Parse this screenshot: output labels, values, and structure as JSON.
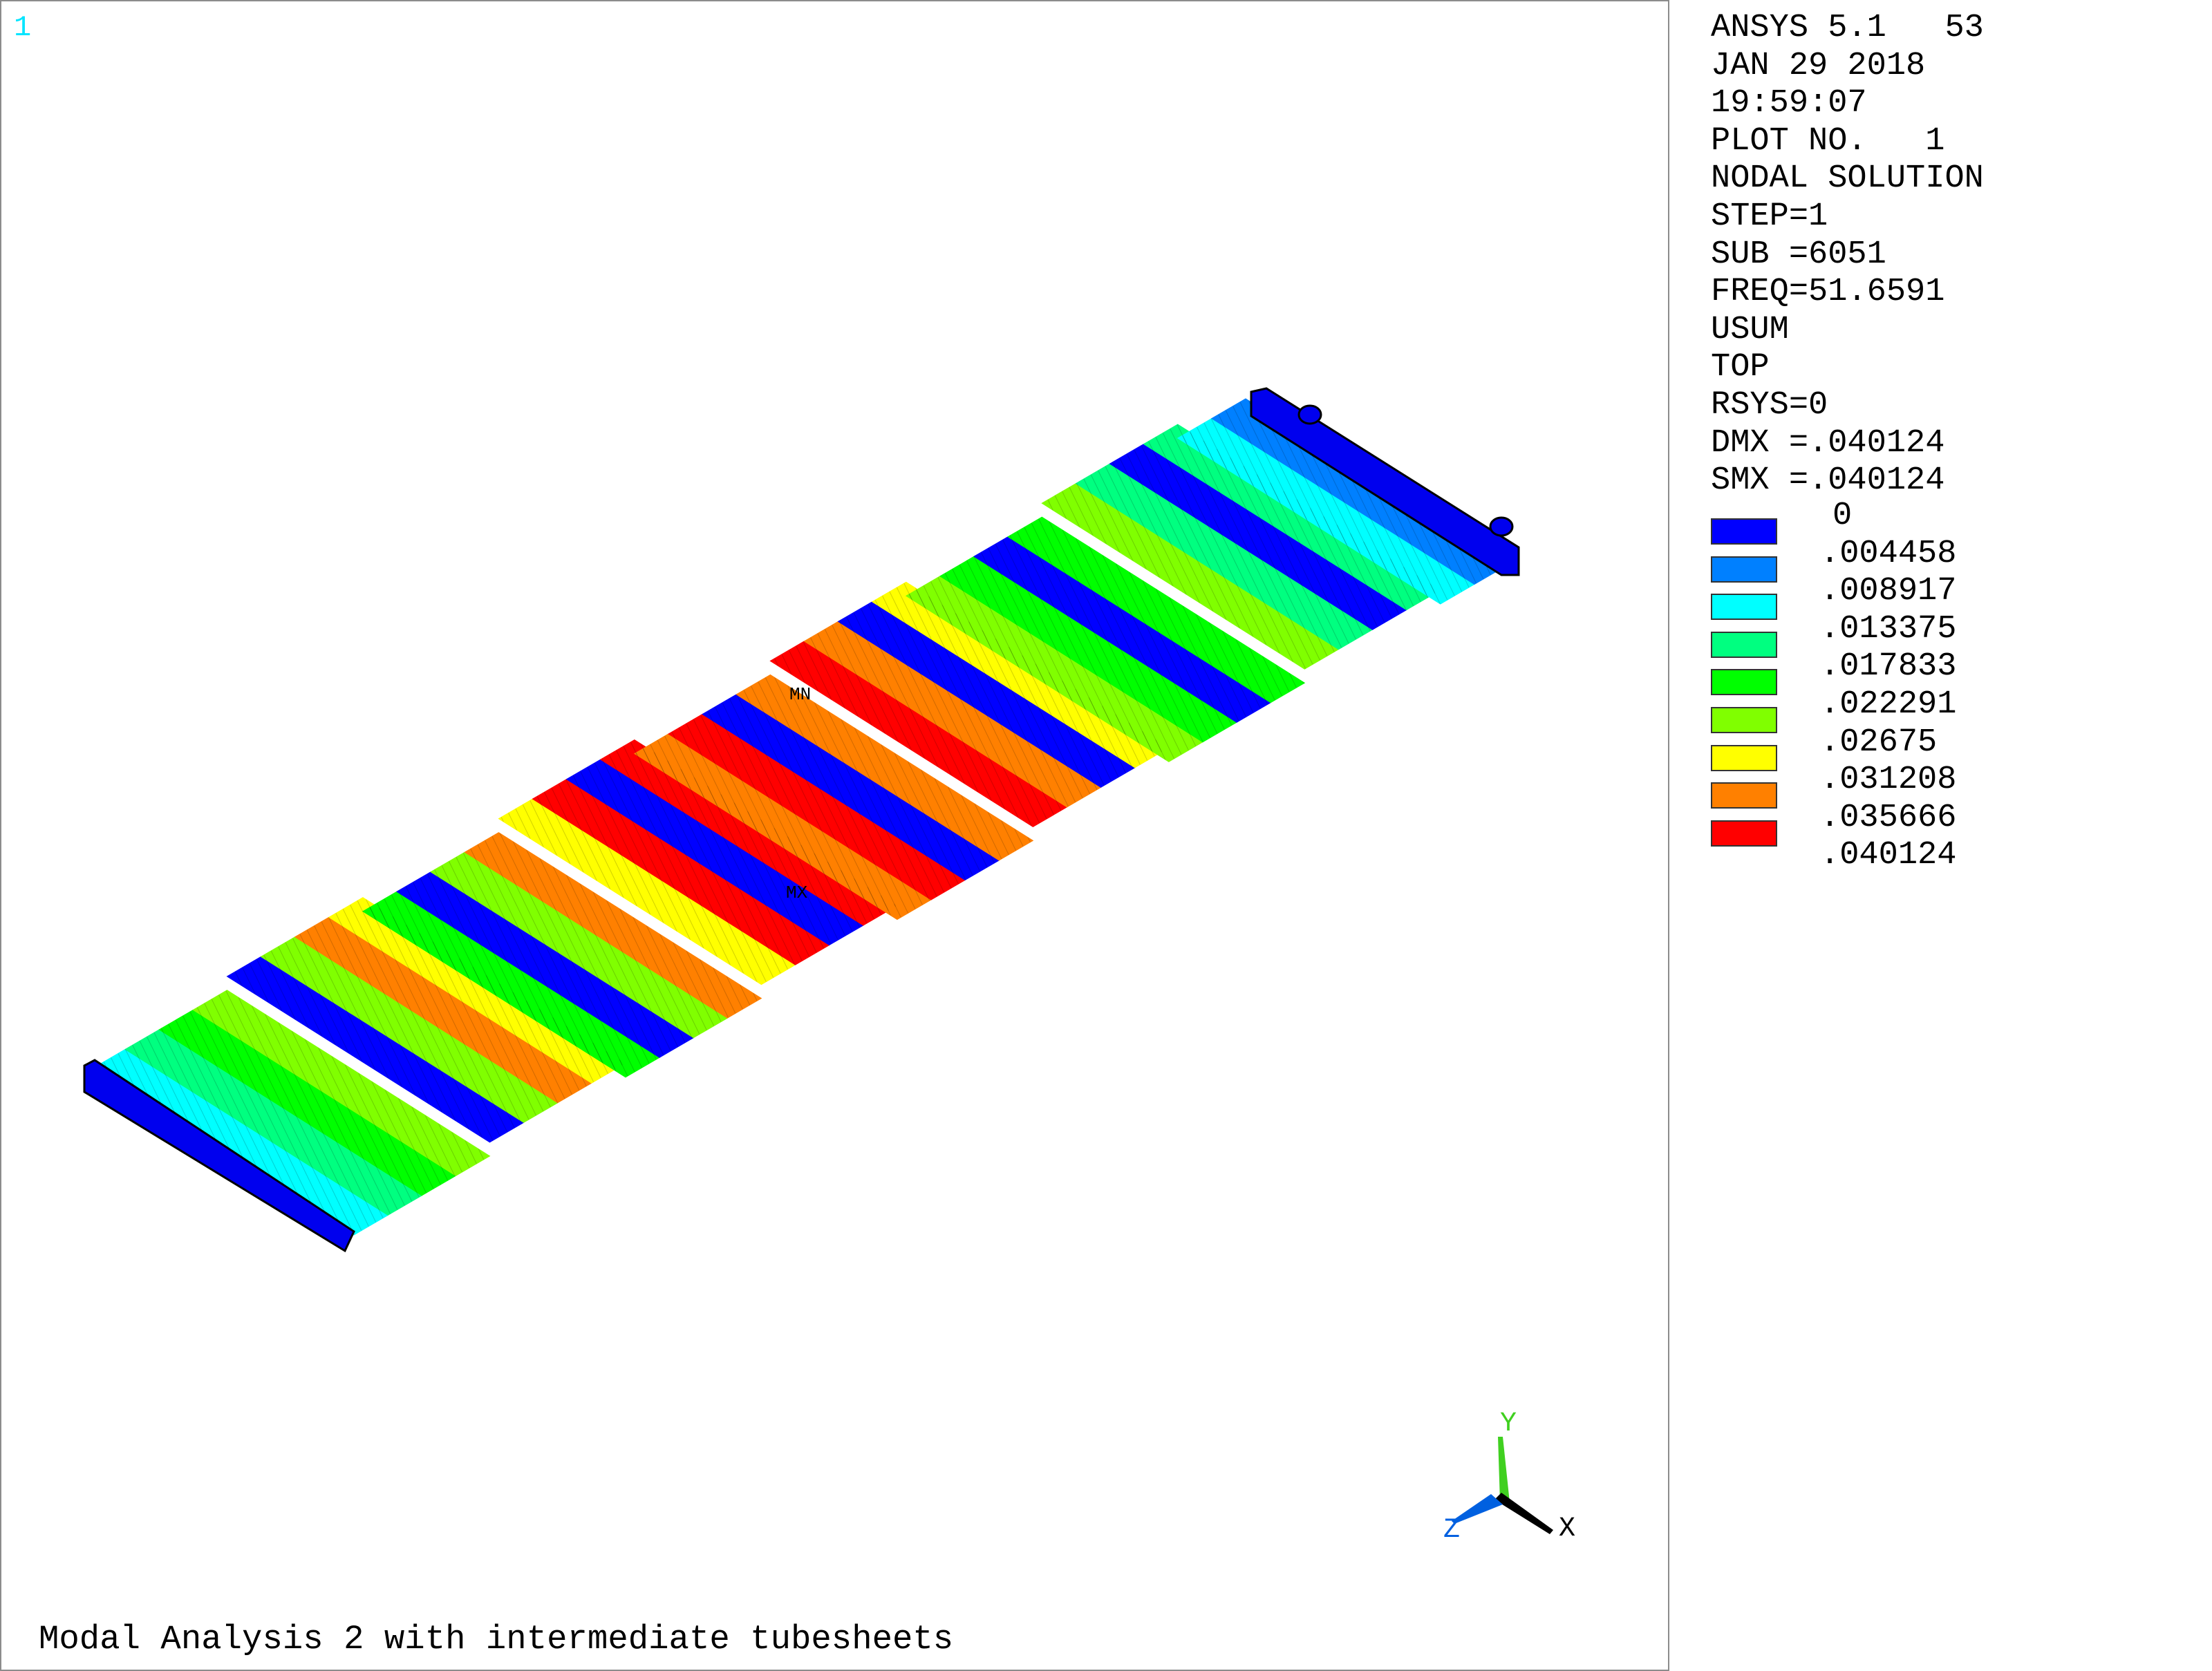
{
  "window_number": "1",
  "info_lines": [
    "ANSYS 5.1   53",
    "JAN 29 2018",
    "19:59:07",
    "PLOT NO.   1",
    "NODAL SOLUTION",
    "STEP=1",
    "SUB =6051",
    "FREQ=51.6591",
    "USUM",
    "TOP",
    "RSYS=0",
    "DMX =.040124",
    "SMX =.040124"
  ],
  "legend": {
    "values": [
      "0",
      ".004458",
      ".008917",
      ".013375",
      ".017833",
      ".022291",
      ".02675",
      ".031208",
      ".035666",
      ".040124"
    ],
    "colors": [
      "#0000ff",
      "#0080ff",
      "#00ffff",
      "#00ff80",
      "#00ff00",
      "#80ff00",
      "#ffff00",
      "#ff8000",
      "#ff0000"
    ]
  },
  "markers": {
    "min": "MN",
    "max": "MX"
  },
  "triad": {
    "x": "X",
    "y": "Y",
    "z": "Z"
  },
  "title": "Modal Analysis 2 with intermediate tubesheets"
}
